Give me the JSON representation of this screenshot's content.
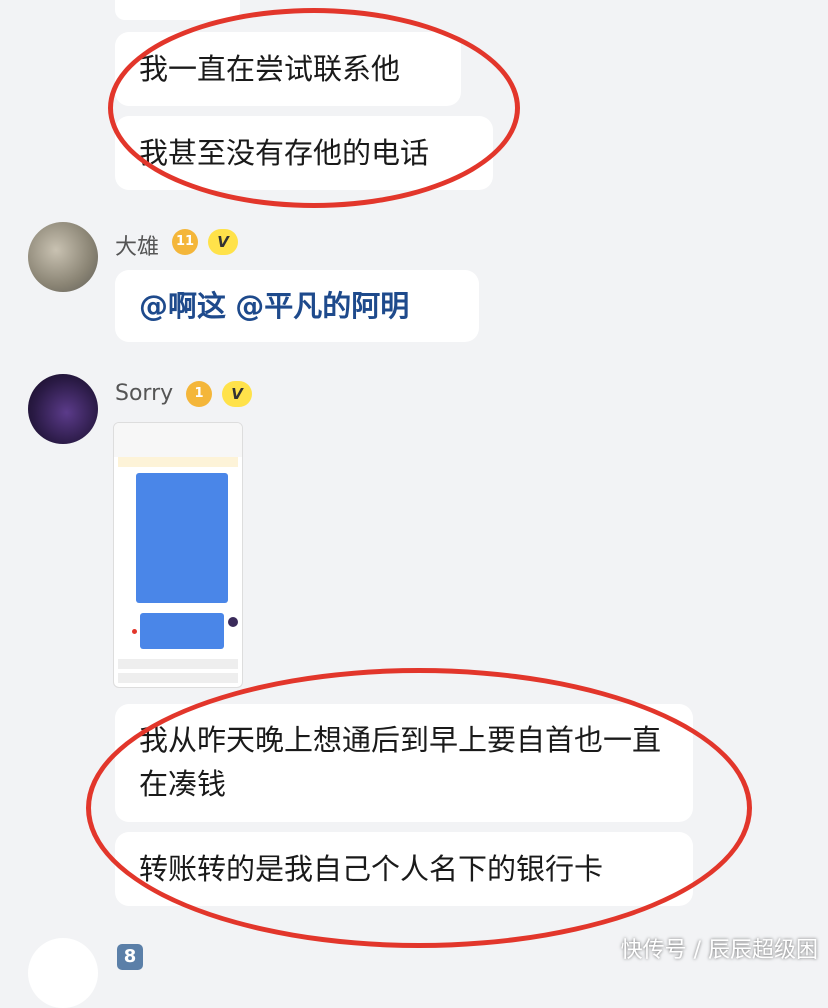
{
  "messages": {
    "m1": "我一直在尝试联系他",
    "m2": "我甚至没有存他的电话",
    "m3_mention1": "@啊这",
    "m3_mention2": "@平凡的阿明",
    "m4": "我从昨天晚上想通后到早上要自首也一直在凑钱",
    "m5": "转账转的是我自己个人名下的银行卡"
  },
  "users": {
    "daxiong": {
      "name": "大雄",
      "level": "11",
      "v": "V"
    },
    "sorry": {
      "name": "Sorry",
      "level": "1",
      "v": "V"
    }
  },
  "unread_badge": "8",
  "watermark": "快传号 / 辰辰超级困",
  "colors": {
    "highlight_ring": "#e2362b",
    "mention": "#1e4a8c",
    "background": "#f2f3f5"
  }
}
